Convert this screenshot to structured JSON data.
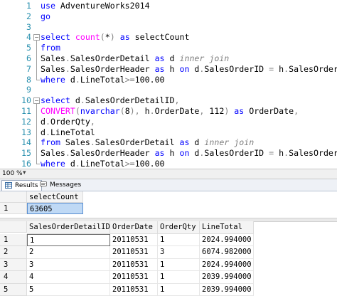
{
  "editor": {
    "lines": [
      {
        "n": "1",
        "segs": [
          [
            "kw",
            "use"
          ],
          [
            "plain",
            " AdventureWorks2014"
          ]
        ]
      },
      {
        "n": "2",
        "segs": [
          [
            "kw",
            "go"
          ]
        ]
      },
      {
        "n": "3",
        "segs": []
      },
      {
        "n": "4",
        "segs": [
          [
            "kw",
            "select"
          ],
          [
            "plain",
            " "
          ],
          [
            "fn",
            "count"
          ],
          [
            "gr",
            "("
          ],
          [
            "plain",
            "*"
          ],
          [
            "gr",
            ")"
          ],
          [
            "plain",
            " "
          ],
          [
            "kw",
            "as"
          ],
          [
            "plain",
            " selectCount"
          ]
        ]
      },
      {
        "n": "5",
        "segs": [
          [
            "kw",
            "from"
          ]
        ]
      },
      {
        "n": "6",
        "segs": [
          [
            "plain",
            "Sales"
          ],
          [
            "gr",
            "."
          ],
          [
            "plain",
            "SalesOrderDetail "
          ],
          [
            "kw",
            "as"
          ],
          [
            "plain",
            " d "
          ],
          [
            "it",
            "inner join"
          ]
        ]
      },
      {
        "n": "7",
        "segs": [
          [
            "plain",
            "Sales"
          ],
          [
            "gr",
            "."
          ],
          [
            "plain",
            "SalesOrderHeader "
          ],
          [
            "kw",
            "as"
          ],
          [
            "plain",
            " h "
          ],
          [
            "kw",
            "on"
          ],
          [
            "plain",
            " d"
          ],
          [
            "gr",
            "."
          ],
          [
            "plain",
            "SalesOrderID "
          ],
          [
            "gr",
            "="
          ],
          [
            "plain",
            " h"
          ],
          [
            "gr",
            "."
          ],
          [
            "plain",
            "SalesOrderID"
          ]
        ]
      },
      {
        "n": "8",
        "segs": [
          [
            "kw",
            "where"
          ],
          [
            "plain",
            " d"
          ],
          [
            "gr",
            "."
          ],
          [
            "plain",
            "LineTotal"
          ],
          [
            "gr",
            ">="
          ],
          [
            "plain",
            "100.00"
          ]
        ]
      },
      {
        "n": "9",
        "segs": []
      },
      {
        "n": "10",
        "segs": [
          [
            "kw",
            "select"
          ],
          [
            "plain",
            " d"
          ],
          [
            "gr",
            "."
          ],
          [
            "plain",
            "SalesOrderDetailID"
          ],
          [
            "gr",
            ","
          ]
        ]
      },
      {
        "n": "11",
        "segs": [
          [
            "fn",
            "CONVERT"
          ],
          [
            "gr",
            "("
          ],
          [
            "kw",
            "nvarchar"
          ],
          [
            "gr",
            "("
          ],
          [
            "plain",
            "8"
          ],
          [
            "gr",
            "),"
          ],
          [
            "plain",
            " h"
          ],
          [
            "gr",
            "."
          ],
          [
            "plain",
            "OrderDate"
          ],
          [
            "gr",
            ","
          ],
          [
            "plain",
            " 112"
          ],
          [
            "gr",
            ")"
          ],
          [
            "plain",
            " "
          ],
          [
            "kw",
            "as"
          ],
          [
            "plain",
            " OrderDate"
          ],
          [
            "gr",
            ","
          ]
        ]
      },
      {
        "n": "12",
        "segs": [
          [
            "plain",
            "d"
          ],
          [
            "gr",
            "."
          ],
          [
            "plain",
            "OrderQty"
          ],
          [
            "gr",
            ","
          ]
        ]
      },
      {
        "n": "13",
        "segs": [
          [
            "plain",
            "d"
          ],
          [
            "gr",
            "."
          ],
          [
            "plain",
            "LineTotal"
          ]
        ]
      },
      {
        "n": "14",
        "segs": [
          [
            "kw",
            "from"
          ],
          [
            "plain",
            " Sales"
          ],
          [
            "gr",
            "."
          ],
          [
            "plain",
            "SalesOrderDetail "
          ],
          [
            "kw",
            "as"
          ],
          [
            "plain",
            " d "
          ],
          [
            "it",
            "inner join"
          ]
        ]
      },
      {
        "n": "15",
        "segs": [
          [
            "plain",
            "Sales"
          ],
          [
            "gr",
            "."
          ],
          [
            "plain",
            "SalesOrderHeader "
          ],
          [
            "kw",
            "as"
          ],
          [
            "plain",
            " h "
          ],
          [
            "kw",
            "on"
          ],
          [
            "plain",
            " d"
          ],
          [
            "gr",
            "."
          ],
          [
            "plain",
            "SalesOrderID "
          ],
          [
            "gr",
            "="
          ],
          [
            "plain",
            " h"
          ],
          [
            "gr",
            "."
          ],
          [
            "plain",
            "SalesOrderID"
          ]
        ]
      },
      {
        "n": "16",
        "segs": [
          [
            "kw",
            "where"
          ],
          [
            "plain",
            " d"
          ],
          [
            "gr",
            "."
          ],
          [
            "plain",
            "LineTotal"
          ],
          [
            "gr",
            ">="
          ],
          [
            "plain",
            "100.00"
          ]
        ]
      }
    ],
    "fold_starts": [
      "4",
      "10"
    ],
    "colors": {
      "keyword": "#0000ff",
      "function": "#ff00ff",
      "operator": "#808080",
      "line_number": "#2b91af"
    }
  },
  "statusbar": {
    "zoom": "100 %"
  },
  "tabs": [
    {
      "label": "Results",
      "icon": "grid-icon",
      "active": true
    },
    {
      "label": "Messages",
      "icon": "messages-icon",
      "active": false
    }
  ],
  "result1": {
    "columns": [
      "selectCount"
    ],
    "rows": [
      [
        "1",
        "63605"
      ]
    ]
  },
  "result2": {
    "columns": [
      "SalesOrderDetailID",
      "OrderDate",
      "OrderQty",
      "LineTotal"
    ],
    "rows": [
      [
        "1",
        "1",
        "20110531",
        "1",
        "2024.994000"
      ],
      [
        "2",
        "2",
        "20110531",
        "3",
        "6074.982000"
      ],
      [
        "3",
        "3",
        "20110531",
        "1",
        "2024.994000"
      ],
      [
        "4",
        "4",
        "20110531",
        "1",
        "2039.994000"
      ],
      [
        "5",
        "5",
        "20110531",
        "1",
        "2039.994000"
      ]
    ]
  }
}
